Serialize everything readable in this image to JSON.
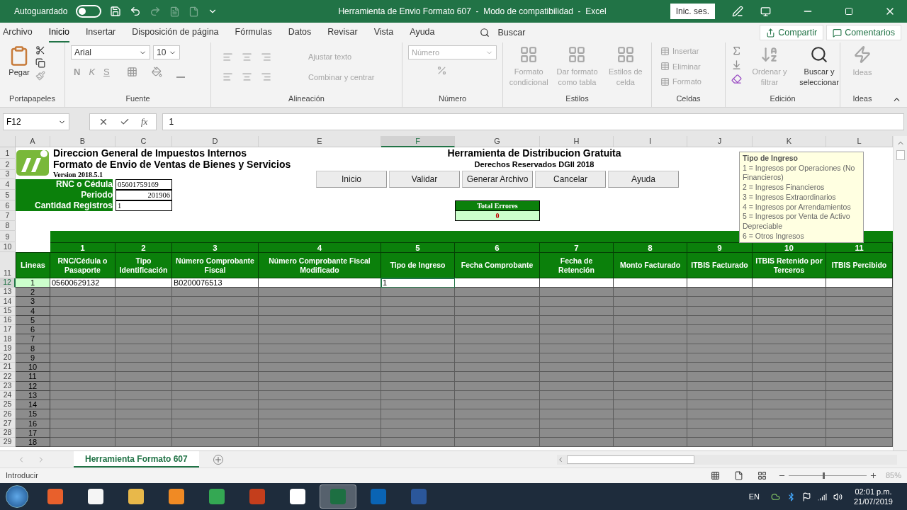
{
  "window": {
    "autosave_label": "Autoguardado",
    "autosave_on": false,
    "title": "Herramienta de Envio Formato 607  -  Modo de compatibilidad  -  Excel",
    "sign_in": "Inic. ses."
  },
  "menu_tabs": [
    {
      "label": "Archivo",
      "selected": false
    },
    {
      "label": "Inicio",
      "selected": true
    },
    {
      "label": "Insertar",
      "selected": false
    },
    {
      "label": "Disposición de página",
      "selected": false
    },
    {
      "label": "Fórmulas",
      "selected": false
    },
    {
      "label": "Datos",
      "selected": false
    },
    {
      "label": "Revisar",
      "selected": false
    },
    {
      "label": "Vista",
      "selected": false
    },
    {
      "label": "Ayuda",
      "selected": false
    }
  ],
  "search": "Buscar",
  "share": "Compartir",
  "comments": "Comentarios",
  "ribbon": {
    "clipboard": {
      "label": "Portapapeles",
      "paste": "Pegar"
    },
    "font": {
      "label": "Fuente",
      "name": "Arial",
      "size": "10",
      "bold": "N",
      "italic": "K",
      "underline": "S"
    },
    "alignment": {
      "label": "Alineación",
      "wrap": "Ajustar texto",
      "merge": "Combinar y centrar",
      "disabled": true
    },
    "number": {
      "label": "Número",
      "format": "Número",
      "disabled": true
    },
    "styles": {
      "label": "Estilos",
      "items": [
        {
          "label": "Formato condicional",
          "disabled": true
        },
        {
          "label": "Dar formato como tabla",
          "disabled": true
        },
        {
          "label": "Estilos de celda",
          "disabled": true
        }
      ]
    },
    "cells": {
      "label": "Celdas",
      "items": [
        {
          "label": "Insertar",
          "disabled": true
        },
        {
          "label": "Eliminar",
          "disabled": true
        },
        {
          "label": "Formato",
          "disabled": true
        }
      ]
    },
    "editing": {
      "label": "Edición",
      "items": [
        {
          "label": "Ordenar y filtrar",
          "disabled": true
        },
        {
          "label": "Buscar y seleccionar",
          "disabled": false
        }
      ]
    },
    "ideas": {
      "label": "Ideas",
      "button": "Ideas",
      "disabled": true
    }
  },
  "formula_bar": {
    "name_box": "F12",
    "fx": "fx",
    "value": "1"
  },
  "sheet": {
    "columns": [
      {
        "label": "A",
        "selected": false
      },
      {
        "label": "B",
        "selected": false
      },
      {
        "label": "C",
        "selected": false
      },
      {
        "label": "D",
        "selected": false
      },
      {
        "label": "E",
        "selected": false
      },
      {
        "label": "F",
        "selected": true
      },
      {
        "label": "G",
        "selected": false
      },
      {
        "label": "H",
        "selected": false
      },
      {
        "label": "I",
        "selected": false
      },
      {
        "label": "J",
        "selected": false
      },
      {
        "label": "K",
        "selected": false
      },
      {
        "label": "L",
        "selected": false
      }
    ],
    "row_headers": [
      {
        "label": "1",
        "selected": false
      },
      {
        "label": "2",
        "selected": false
      },
      {
        "label": "3",
        "selected": false
      },
      {
        "label": "4",
        "selected": false
      },
      {
        "label": "5",
        "selected": false
      },
      {
        "label": "6",
        "selected": false
      },
      {
        "label": "7",
        "selected": false
      },
      {
        "label": "8",
        "selected": false
      },
      {
        "label": "9",
        "selected": false
      },
      {
        "label": "10",
        "selected": false
      },
      {
        "label": "11",
        "selected": false
      },
      {
        "label": "12",
        "selected": true
      },
      {
        "label": "13",
        "selected": false
      },
      {
        "label": "14",
        "selected": false
      },
      {
        "label": "15",
        "selected": false
      },
      {
        "label": "16",
        "selected": false
      },
      {
        "label": "17",
        "selected": false
      },
      {
        "label": "18",
        "selected": false
      },
      {
        "label": "19",
        "selected": false
      },
      {
        "label": "20",
        "selected": false
      },
      {
        "label": "21",
        "selected": false
      },
      {
        "label": "22",
        "selected": false
      },
      {
        "label": "23",
        "selected": false
      },
      {
        "label": "24",
        "selected": false
      },
      {
        "label": "25",
        "selected": false
      },
      {
        "label": "26",
        "selected": false
      },
      {
        "label": "27",
        "selected": false
      },
      {
        "label": "28",
        "selected": false
      },
      {
        "label": "29",
        "selected": false
      }
    ],
    "title": "Direccion General de Impuestos Internos",
    "subtitle": "Formato de Envio de Ventas de Bienes y Servicios",
    "version": "Version 2018.5.1",
    "tool_title": "Herramienta de Distribucion Gratuita",
    "rights": "Derechos Reservados DGII 2018",
    "buttons": [
      "Inicio",
      "Validar",
      "Generar Archivo",
      "Cancelar",
      "Ayuda"
    ],
    "info": [
      {
        "label": "RNC o Cédula",
        "value": "05601759169",
        "right_aligned": false
      },
      {
        "label": "Periodo",
        "value": "201906",
        "right_aligned": true
      },
      {
        "label": "Cantidad Registros",
        "value": "1",
        "right_aligned": false
      }
    ],
    "errors": {
      "label": "Total Errores",
      "value": "0"
    },
    "field_numbers": [
      "1",
      "2",
      "3",
      "4",
      "5",
      "6",
      "7",
      "8",
      "9",
      "10",
      "11"
    ],
    "lines_header": "Lineas",
    "field_headers": [
      "RNC/Cédula o Pasaporte",
      "Tipo Identificación",
      "Número Comprobante Fiscal",
      "Número Comprobante Fiscal Modificado",
      "Tipo de Ingreso",
      "Fecha Comprobante",
      "Fecha de Retención",
      "Monto Facturado",
      "ITBIS Facturado",
      "ITBIS Retenido por Terceros",
      "ITBIS Percibido"
    ],
    "rows": [
      {
        "line": "1",
        "active": true,
        "cells": [
          {
            "text": "05600629132",
            "selected": false
          },
          {
            "selected": false
          },
          {
            "text": "B0200076513",
            "selected": false
          },
          {
            "selected": false
          },
          {
            "text": "1",
            "selected": true
          },
          {
            "selected": false
          },
          {
            "selected": false
          },
          {
            "selected": false
          },
          {
            "selected": false
          },
          {
            "selected": false
          },
          {
            "selected": false
          }
        ]
      },
      {
        "line": "2",
        "active": false
      },
      {
        "line": "3",
        "active": false
      },
      {
        "line": "4",
        "active": false
      },
      {
        "line": "5",
        "active": false
      },
      {
        "line": "6",
        "active": false
      },
      {
        "line": "7",
        "active": false
      },
      {
        "line": "8",
        "active": false
      },
      {
        "line": "9",
        "active": false
      },
      {
        "line": "10",
        "active": false
      },
      {
        "line": "11",
        "active": false
      },
      {
        "line": "12",
        "active": false
      },
      {
        "line": "13",
        "active": false
      },
      {
        "line": "14",
        "active": false
      },
      {
        "line": "15",
        "active": false
      },
      {
        "line": "16",
        "active": false
      },
      {
        "line": "17",
        "active": false
      },
      {
        "line": "18",
        "active": false
      }
    ],
    "comment": {
      "title": "Tipo de Ingreso",
      "lines": [
        "1 = Ingresos por Operaciones (No Financieros)",
        "2 = Ingresos Financieros",
        "3 = Ingresos Extraordinarios",
        "4 = Ingresos por Arrendamientos",
        "5 = Ingresos por Venta de Activo Depreciable",
        "6 = Otros Ingresos"
      ]
    }
  },
  "sheet_tabs": [
    {
      "label": "Herramienta Formato 607",
      "selected": true
    }
  ],
  "status": {
    "mode": "Introducir",
    "zoom": "85%",
    "zoom_slider": {
      "level": 0.45
    }
  },
  "taskbar": {
    "apps": [
      {
        "kind": "media",
        "active": false
      },
      {
        "kind": "page",
        "active": false
      },
      {
        "kind": "folder",
        "active": false
      },
      {
        "kind": "draw",
        "active": false
      },
      {
        "kind": "browser",
        "active": false
      },
      {
        "kind": "slides",
        "active": false
      },
      {
        "kind": "tool",
        "active": false
      },
      {
        "kind": "sheet",
        "active": true
      },
      {
        "kind": "mail",
        "active": false
      },
      {
        "kind": "doc",
        "active": false
      }
    ],
    "language": "EN",
    "time": "02:01 p.m.",
    "date": "21/07/2019"
  }
}
